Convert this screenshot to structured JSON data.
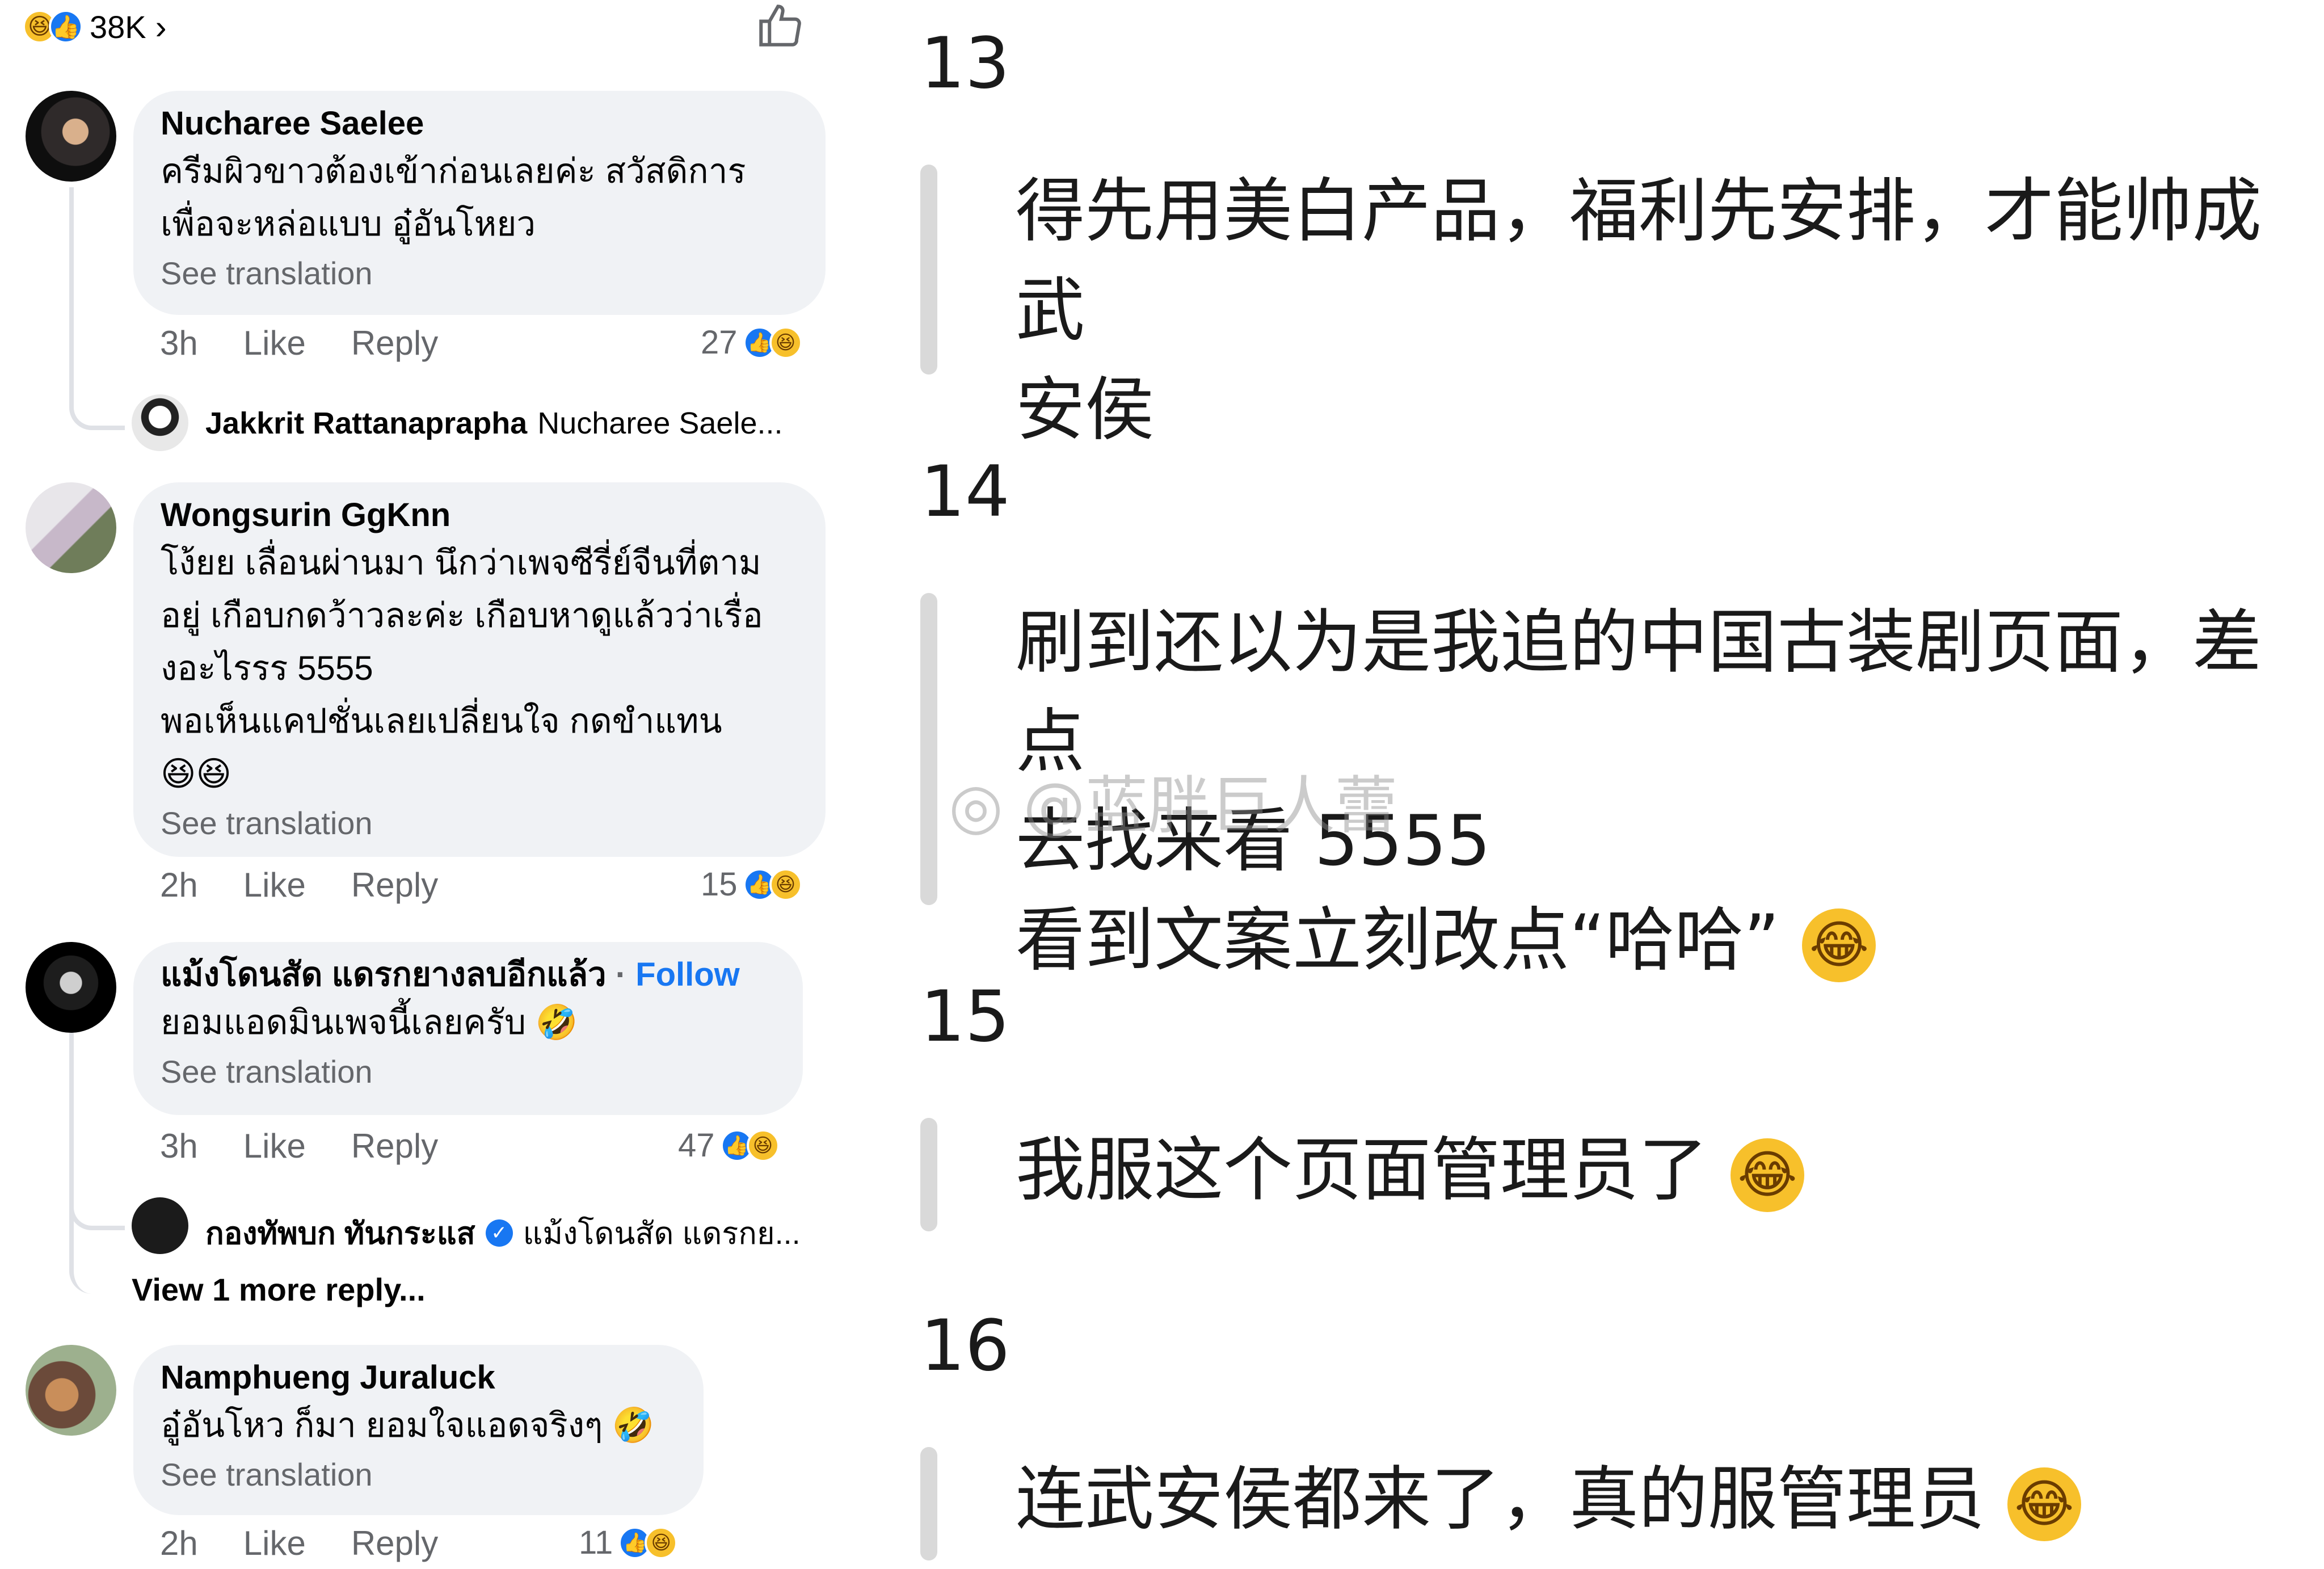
{
  "header": {
    "reaction_count": "38K",
    "chevron": "›"
  },
  "comments": [
    {
      "author": "Nucharee Saelee",
      "text": "ครีมผิวขาวต้องเข้าก่อนเลยค่ะ สวัสดิการ\nเพื่อจะหล่อแบบ อู๋อันโหยว",
      "see_translation": "See translation",
      "time": "3h",
      "like": "Like",
      "reply": "Reply",
      "reactions": "27",
      "reply_preview": {
        "author": "Jakkrit Rattanaprapha",
        "text": "Nucharee Saele..."
      }
    },
    {
      "author": "Wongsurin GgKnn",
      "text": "โง้ยย เลื่อนผ่านมา นึกว่าเพจซีรี่ย์จีนที่ตาม\nอยู่ เกือบกดว้าวละค่ะ เกือบหาดูแล้วว่าเรื่อ\nงอะไรรร 5555\nพอเห็นแคปชั่นเลยเปลี่ยนใจ กดขำแทน",
      "emoji_line": "😆😆",
      "see_translation": "See translation",
      "time": "2h",
      "like": "Like",
      "reply": "Reply",
      "reactions": "15"
    },
    {
      "author": "แม้งโดนสัด แดรกยางลบอีกแล้ว",
      "follow": "Follow",
      "text": "ยอมแอดมินเพจนี้เลยครับ 🤣",
      "see_translation": "See translation",
      "time": "3h",
      "like": "Like",
      "reply": "Reply",
      "reactions": "47",
      "reply_preview": {
        "author": "กองทัพบก ทันกระแส",
        "text": "แม้งโดนสัด แดรกย..."
      },
      "view_more": "View 1 more reply..."
    },
    {
      "author": "Namphueng Juraluck",
      "text": "อู๋อันโหว ก็มา ยอมใจแอดจริงๆ 🤣",
      "see_translation": "See translation",
      "time": "2h",
      "like": "Like",
      "reply": "Reply",
      "reactions": "11"
    }
  ],
  "translations": [
    {
      "num": "13",
      "text": "得先用美白产品，福利先安排，才能帅成武\n安侯"
    },
    {
      "num": "14",
      "text": "刷到还以为是我追的中国古装剧页面，差点\n去找来看 5555\n看到文案立刻改点“哈哈”"
    },
    {
      "num": "15",
      "text": "我服这个页面管理员了"
    },
    {
      "num": "16",
      "text": "连武安侯都来了，真的服管理员"
    }
  ],
  "watermark": "@蓝胖巨人蕾",
  "icons": [
    "like-icon",
    "haha-icon",
    "thumbs-up-icon",
    "verified-icon",
    "laughing-emoji-icon"
  ],
  "colors": {
    "bubble": "#f0f2f5",
    "link": "#1877f2",
    "muted": "#65676b",
    "quote_bar": "#d9d9d9"
  }
}
